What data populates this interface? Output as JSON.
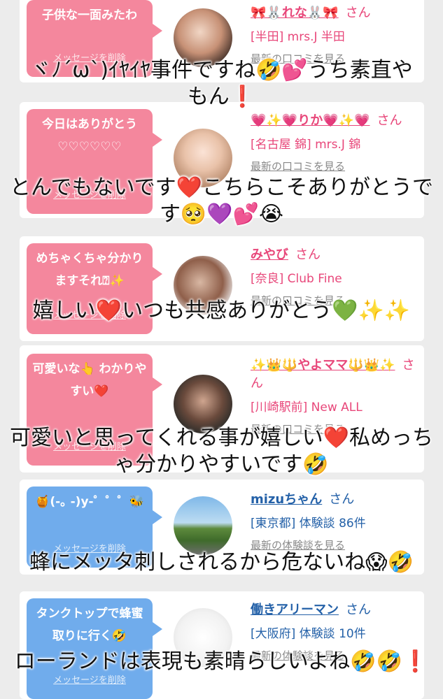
{
  "cards": [
    {
      "message": "子供な一面みたわ",
      "delete_label": "メッセージを削除",
      "name": "🎀🐰れな🐰🎀",
      "san": "さん",
      "shop": "[半田] mrs.J 半田",
      "latest": "最新の口コミを見る",
      "theme": "pink"
    },
    {
      "message": "今日はありがとう♡♡♡♡♡♡",
      "delete_label": "メッセージを削除",
      "name": "💗✨💗りか💗✨💗",
      "san": "さん",
      "shop": "[名古屋 錦] mrs.J 錦",
      "latest": "最新の口コミを見る",
      "theme": "pink"
    },
    {
      "message": "めちゃくちゃ分かりますそれ⍰✨",
      "delete_label": "メッセージを削除",
      "name": "みやび",
      "san": "さん",
      "shop": "[奈良] Club Fine",
      "latest": "最新の口コミを見る",
      "theme": "pink"
    },
    {
      "message": "可愛いな👆 わかりやすい❤️",
      "delete_label": "メッセージを削除",
      "name": "✨👑🔱やよママ🔱👑✨",
      "san": "さん",
      "shop": "[川崎駅前] New ALL",
      "latest": "最新の口コミを見る",
      "theme": "pink"
    },
    {
      "message": "🍯(-｡ -)y-゜゜゜🐝",
      "delete_label": "メッセージを削除",
      "name": "mizuちゃん",
      "san": "さん",
      "shop": "[東京都] 体験談 86件",
      "latest": "最新の体験談を見る",
      "theme": "blue"
    },
    {
      "message": "タンクトップで蜂蜜取りに行く🤣",
      "delete_label": "メッセージを削除",
      "name": "働きアリーマン",
      "san": "さん",
      "shop": "[大阪府] 体験談 10件",
      "latest": "最新の体験談を見る",
      "theme": "blue"
    }
  ],
  "captions": [
    "ヾﾉ´ω`)ｲﾔｲﾔ事件ですね🤣💕うち素直やもん❗️",
    "とんでもないです❤️こちらこそありがとうです🥺💜💕😭",
    "嬉しい❤️いつも共感ありがとう💚✨✨",
    "可愛いと思ってくれる事が嬉しい❤️私めっちゃ分かりやすいです🤣",
    "蜂にメッタ刺しされるから危ないね😱🤣",
    "ローランドは表現も素晴らしいよね🤣🤣❗️"
  ]
}
